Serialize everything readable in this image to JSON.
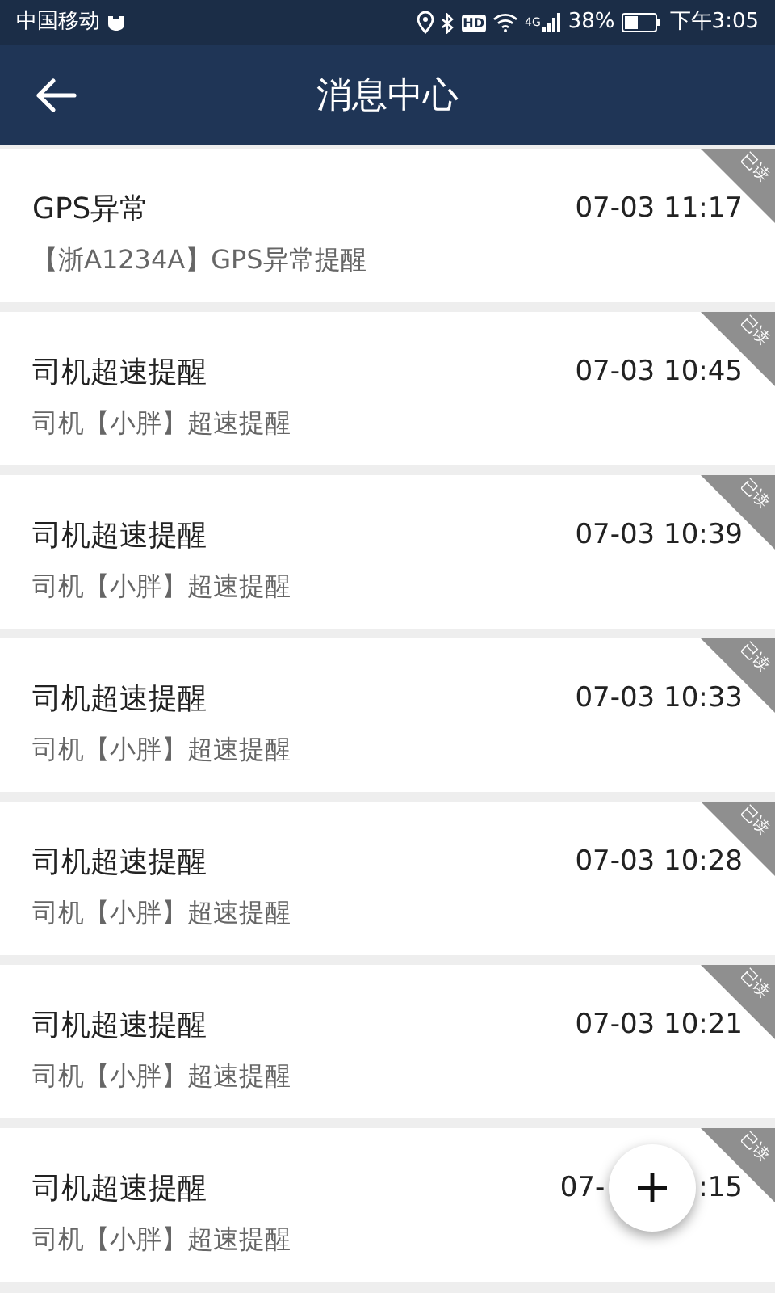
{
  "status_bar": {
    "carrier": "中国移动",
    "hd": "HD",
    "network": "4G",
    "battery": "38%",
    "time": "下午3:05"
  },
  "header": {
    "title": "消息中心"
  },
  "messages": [
    {
      "title": "GPS异常",
      "time": "07-03 11:17",
      "body": "【浙A1234A】GPS异常提醒",
      "read": true,
      "badge": "已读"
    },
    {
      "title": "司机超速提醒",
      "time": "07-03 10:45",
      "body": "司机【小胖】超速提醒",
      "read": true,
      "badge": "已读"
    },
    {
      "title": "司机超速提醒",
      "time": "07-03 10:39",
      "body": "司机【小胖】超速提醒",
      "read": true,
      "badge": "已读"
    },
    {
      "title": "司机超速提醒",
      "time": "07-03 10:33",
      "body": "司机【小胖】超速提醒",
      "read": true,
      "badge": "已读"
    },
    {
      "title": "司机超速提醒",
      "time": "07-03 10:28",
      "body": "司机【小胖】超速提醒",
      "read": true,
      "badge": "已读"
    },
    {
      "title": "司机超速提醒",
      "time": "07-03 10:21",
      "body": "司机【小胖】超速提醒",
      "read": true,
      "badge": "已读"
    },
    {
      "title": "司机超速提醒",
      "time_parts": [
        "07-",
        ":15"
      ],
      "body": "司机【小胖】超速提醒",
      "read": true,
      "badge": "已读"
    }
  ]
}
